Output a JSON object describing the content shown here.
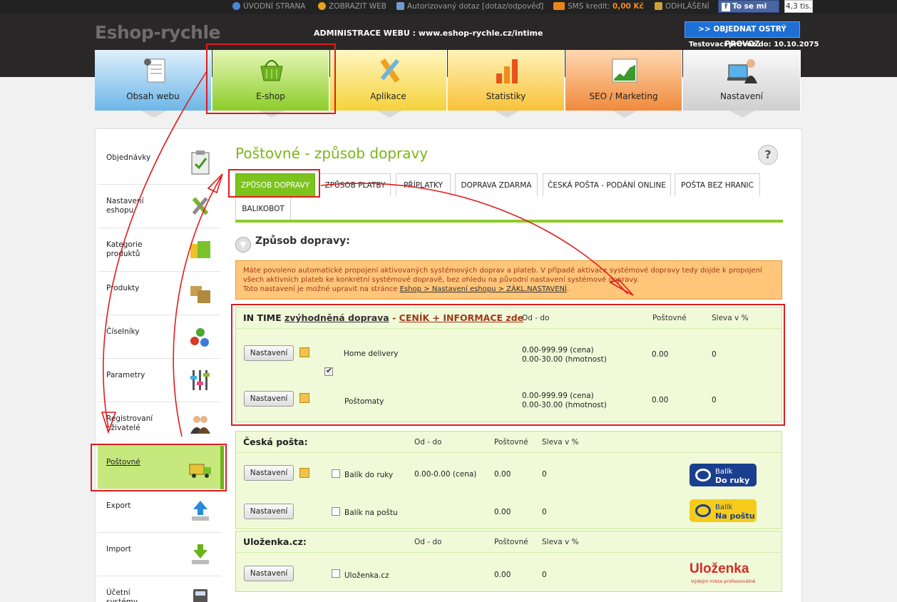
{
  "topbar": {
    "home": "ÚVODNÍ STRANA",
    "show_web": "ZOBRAZIT WEB",
    "query": "Autorizovaný dotaz [dotaz/odpověď]",
    "sms_label": "SMS kredit:",
    "sms_value": "0,00 Kč",
    "logout": "ODHLÁŠENÍ",
    "fb_like": "To se mi líbí",
    "fb_count": "4,3 tis."
  },
  "header": {
    "logo": "Eshop-rychle",
    "admin_title": "ADMINISTRACE WEBU : www.eshop-rychle.cz/intime",
    "order_button": ">> OBJEDNAT OSTRÝ PROVOZ",
    "testing_until": "Testovací provoz do: 10.10.2075"
  },
  "tiles": [
    {
      "label": "Obsah webu"
    },
    {
      "label": "E-shop"
    },
    {
      "label": "Aplikace"
    },
    {
      "label": "Statistiky"
    },
    {
      "label": "SEO / Marketing"
    },
    {
      "label": "Nastavení"
    }
  ],
  "sidebar": [
    {
      "label": "Objednávky"
    },
    {
      "label": "Nastavení eshopu"
    },
    {
      "label": "Kategorie produktů"
    },
    {
      "label": "Produkty"
    },
    {
      "label": "Číselníky"
    },
    {
      "label": "Parametry"
    },
    {
      "label": "Registrovaní uživatelé"
    },
    {
      "label": "Poštovné"
    },
    {
      "label": "Export"
    },
    {
      "label": "Import"
    },
    {
      "label": "Účetní systémy"
    }
  ],
  "page_title": "Poštovné - způsob dopravy",
  "help": "?",
  "tabs": [
    {
      "label": "ZPŮSOB DOPRAVY"
    },
    {
      "label": "ZPŮSOB PLATBY"
    },
    {
      "label": "PŘÍPLATKY"
    },
    {
      "label": "DOPRAVA ZDARMA"
    },
    {
      "label": "ČESKÁ POŠTA - PODÁNÍ ONLINE"
    },
    {
      "label": "POŠTA BEZ HRANIC"
    },
    {
      "label": "BALIKOBOT"
    }
  ],
  "section_title": "Způsob dopravy:",
  "notice": {
    "text": "Máte povoleno automatické propojení aktivovaných systémových doprav a plateb. V případě aktivace systémové dopravy tedy dojde k propojení všech aktivních plateb ke konkrétní systémové dopravě, bez ohledu na původní nastavení systémové dopravy.",
    "text2": "Toto nastavení je možné upravit na stránce",
    "link": "Eshop > Nastavení eshopu > ZÁKL.NASTAVENÍ",
    "end": "."
  },
  "columns": {
    "range": "Od - do",
    "postage": "Poštovné",
    "discount": "Sleva v %"
  },
  "intime": {
    "name": "IN TIME",
    "link": "zvýhodněná doprava",
    "dash": "-",
    "price_link": "CENÍK + INFORMACE zde",
    "rows": [
      {
        "button": "Nastavení",
        "name": "Home delivery",
        "range1": "0.00-999.99 (cena)",
        "range2": "0.00-30.00 (hmotnost)",
        "postage": "0.00",
        "discount": "0"
      },
      {
        "button": "Nastavení",
        "name": "Poštomaty",
        "range1": "0.00-999.99 (cena)",
        "range2": "0.00-30.00 (hmotnost)",
        "postage": "0.00",
        "discount": "0"
      }
    ]
  },
  "ceska_posta": {
    "name": "Česká pošta:",
    "rows": [
      {
        "button": "Nastavení",
        "name": "Balík do ruky",
        "range": "0.00-0.00 (cena)",
        "postage": "0.00",
        "discount": "0",
        "logo1": "Balík",
        "logo2": "Do ruky"
      },
      {
        "button": "Nastavení",
        "name": "Balík na poštu",
        "range": "",
        "postage": "0.00",
        "discount": "0",
        "logo1": "Balík",
        "logo2": "Na poštu"
      }
    ]
  },
  "ulozenka": {
    "name": "Uloženka.cz:",
    "rows": [
      {
        "button": "Nastavení",
        "name": "Uloženka.cz",
        "postage": "0.00",
        "discount": "0",
        "logo": "Uloženka",
        "logo_sub": "Výdejní místa profesionálně"
      }
    ]
  },
  "colors": {
    "accent_green": "#7cc31e",
    "annotation_red": "#e01c1c",
    "notice_bg": "#ffc67a"
  }
}
